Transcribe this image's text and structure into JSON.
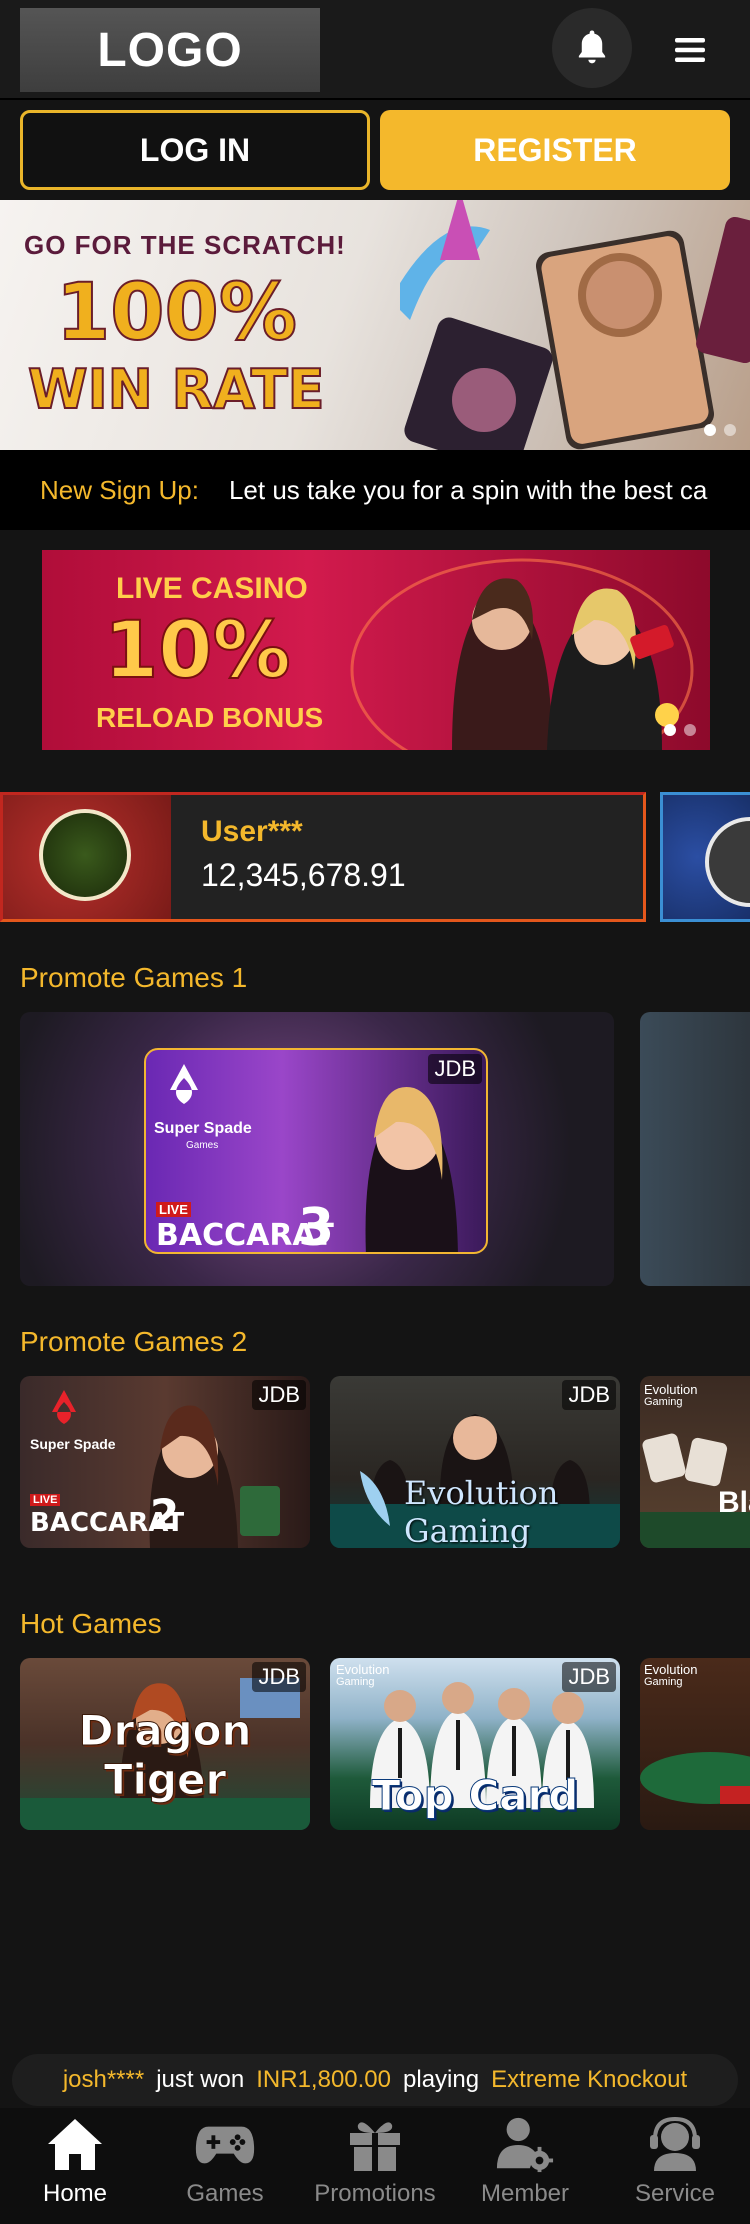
{
  "header": {
    "logo_text": "LOGO"
  },
  "auth": {
    "login_label": "LOG IN",
    "register_label": "REGISTER"
  },
  "hero_banner": {
    "line1": "GO FOR THE SCRATCH!",
    "line2": "100%",
    "line3": "WIN RATE",
    "active_slide": 1,
    "slide_count": 2
  },
  "marquee": {
    "label": "New Sign Up:",
    "text": "Let us take you for a spin with the best ca"
  },
  "promo_banner": {
    "line1": "LIVE CASINO",
    "line2": "10%",
    "line3": "RELOAD BONUS",
    "active_slide": 1,
    "slide_count": 2
  },
  "winner": {
    "name": "User***",
    "amount": "12,345,678.91"
  },
  "sections": {
    "promote1_title": "Promote Games 1",
    "promote2_title": "Promote Games 2",
    "hot_title": "Hot Games"
  },
  "promote1": {
    "brand": "Super Spade",
    "brand_sub": "Games",
    "badge": "JDB",
    "live": "LIVE",
    "game": "BACCARAT",
    "number": "3"
  },
  "promote2": {
    "tiles": [
      {
        "brand": "Super Spade",
        "brand_sub": "Games",
        "live": "LIVE",
        "game": "BACCARAT",
        "number": "2",
        "badge": "JDB"
      },
      {
        "brand": "Evolution",
        "brand_sub": "Gaming",
        "badge": "JDB"
      },
      {
        "brand": "Evolution",
        "brand_sub": "Gaming",
        "game": "Bla"
      }
    ]
  },
  "hot_games": {
    "tiles": [
      {
        "title": "Dragon Tiger",
        "badge": "JDB"
      },
      {
        "title": "Top Card",
        "badge": "JDB",
        "brand": "Evolution",
        "brand_sub": "Gaming"
      },
      {
        "brand": "Evolution",
        "brand_sub": "Gaming"
      }
    ]
  },
  "ticker": {
    "user": "josh****",
    "action": "just won",
    "amount": "INR1,800.00",
    "verb": "playing",
    "game": "Extreme Knockout"
  },
  "bottom_nav": {
    "items": [
      {
        "label": "Home",
        "icon": "home-icon",
        "active": true
      },
      {
        "label": "Games",
        "icon": "gamepad-icon",
        "active": false
      },
      {
        "label": "Promotions",
        "icon": "gift-icon",
        "active": false
      },
      {
        "label": "Member",
        "icon": "member-gear-icon",
        "active": false
      },
      {
        "label": "Service",
        "icon": "headset-icon",
        "active": false
      }
    ]
  },
  "colors": {
    "accent": "#f4b82c",
    "background": "#141414",
    "nav_inactive": "#8a8a8a"
  }
}
